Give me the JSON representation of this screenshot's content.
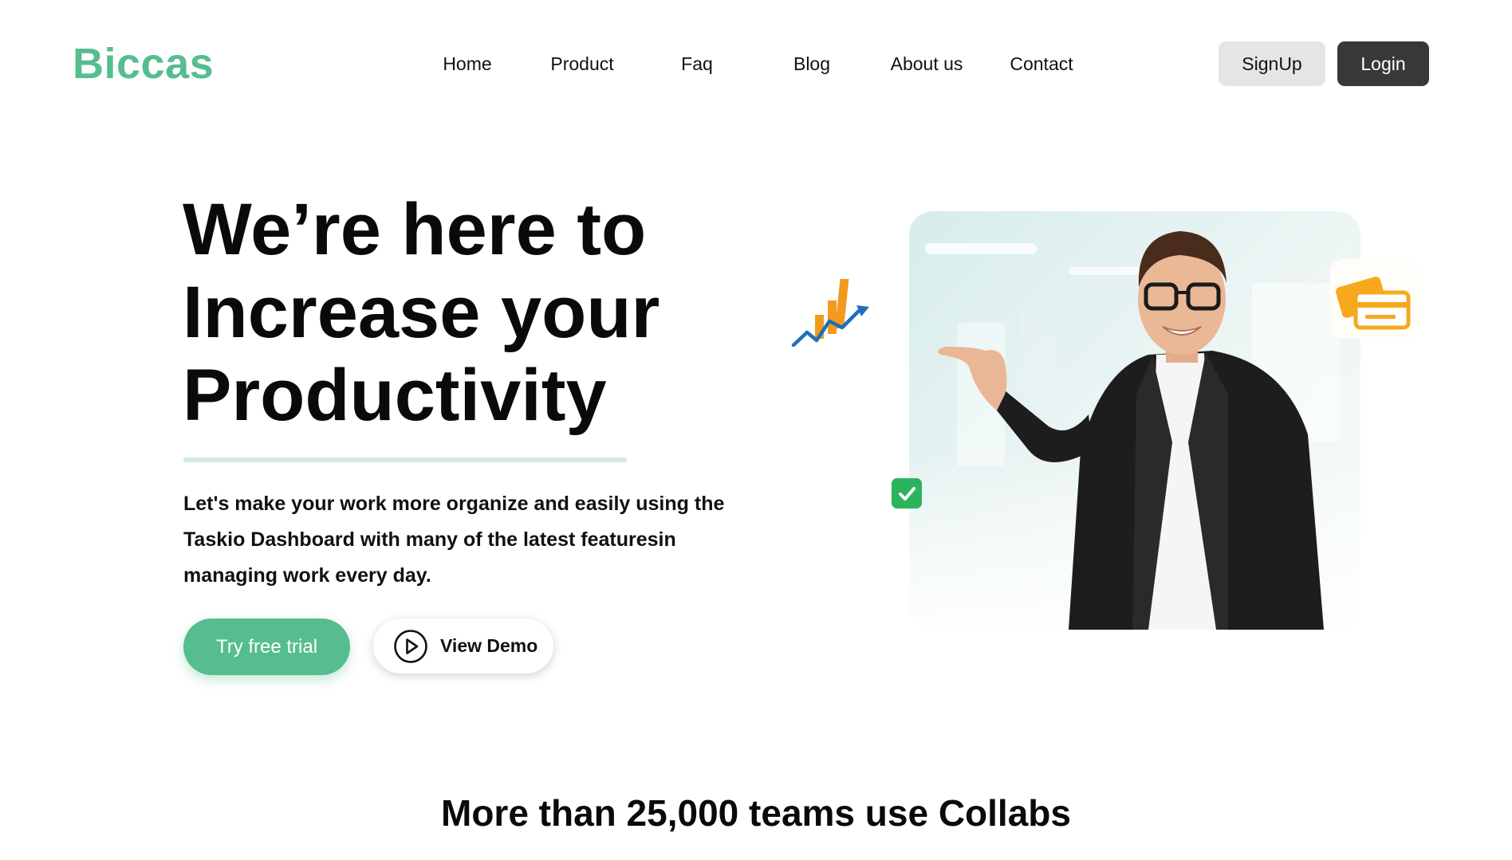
{
  "brand": {
    "name": "Biccas",
    "accent_color": "#56bd8f"
  },
  "nav": {
    "items": [
      {
        "label": "Home"
      },
      {
        "label": "Product"
      },
      {
        "label": "Faq"
      },
      {
        "label": "Blog"
      },
      {
        "label": "About us"
      },
      {
        "label": "Contact"
      }
    ]
  },
  "auth": {
    "signup_label": "SignUp",
    "login_label": "Login"
  },
  "hero": {
    "title_lines": [
      "We’re here to",
      "Increase your",
      "Productivity"
    ],
    "subtitle_lines": [
      "Let's make your work more organize and easily using the",
      "Taskio Dashboard with many of the latest featuresin",
      "managing work every day."
    ],
    "trial_button": "Try free trial",
    "demo_button": "View Demo",
    "icons": {
      "demo": "play-circle-icon",
      "chart": "growth-chart-icon",
      "card": "credit-card-icon",
      "check": "check-icon"
    }
  },
  "teams": {
    "heading": "More than 25,000 teams use Collabs"
  }
}
